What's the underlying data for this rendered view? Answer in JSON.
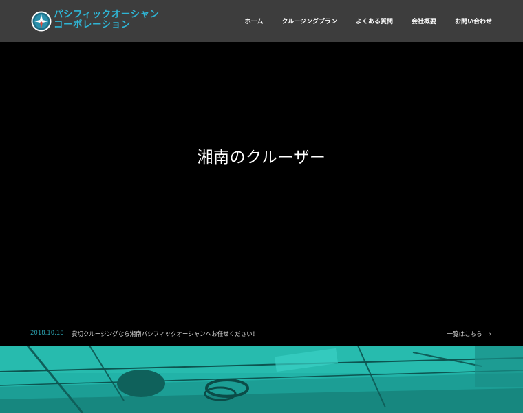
{
  "brand": {
    "name_line1": "パシフィックオーシャン",
    "name_line2": "コーポレーション",
    "accent_color": "#2fb4d4"
  },
  "nav": {
    "items": [
      {
        "label": "ホーム"
      },
      {
        "label": "クルージングプラン"
      },
      {
        "label": "よくある質問"
      },
      {
        "label": "会社概要"
      },
      {
        "label": "お問い合わせ"
      }
    ]
  },
  "hero": {
    "title": "湘南のクルーザー"
  },
  "news": {
    "date": "2018.10.18",
    "text": "貸切クルージングなら湘南パシフィックオーシャンへお任せください！",
    "more_label": "一覧はこちら",
    "more_icon": "chevron-right-icon",
    "date_color": "#2a9dab"
  },
  "photo": {
    "tint_color": "#22b3a8"
  }
}
